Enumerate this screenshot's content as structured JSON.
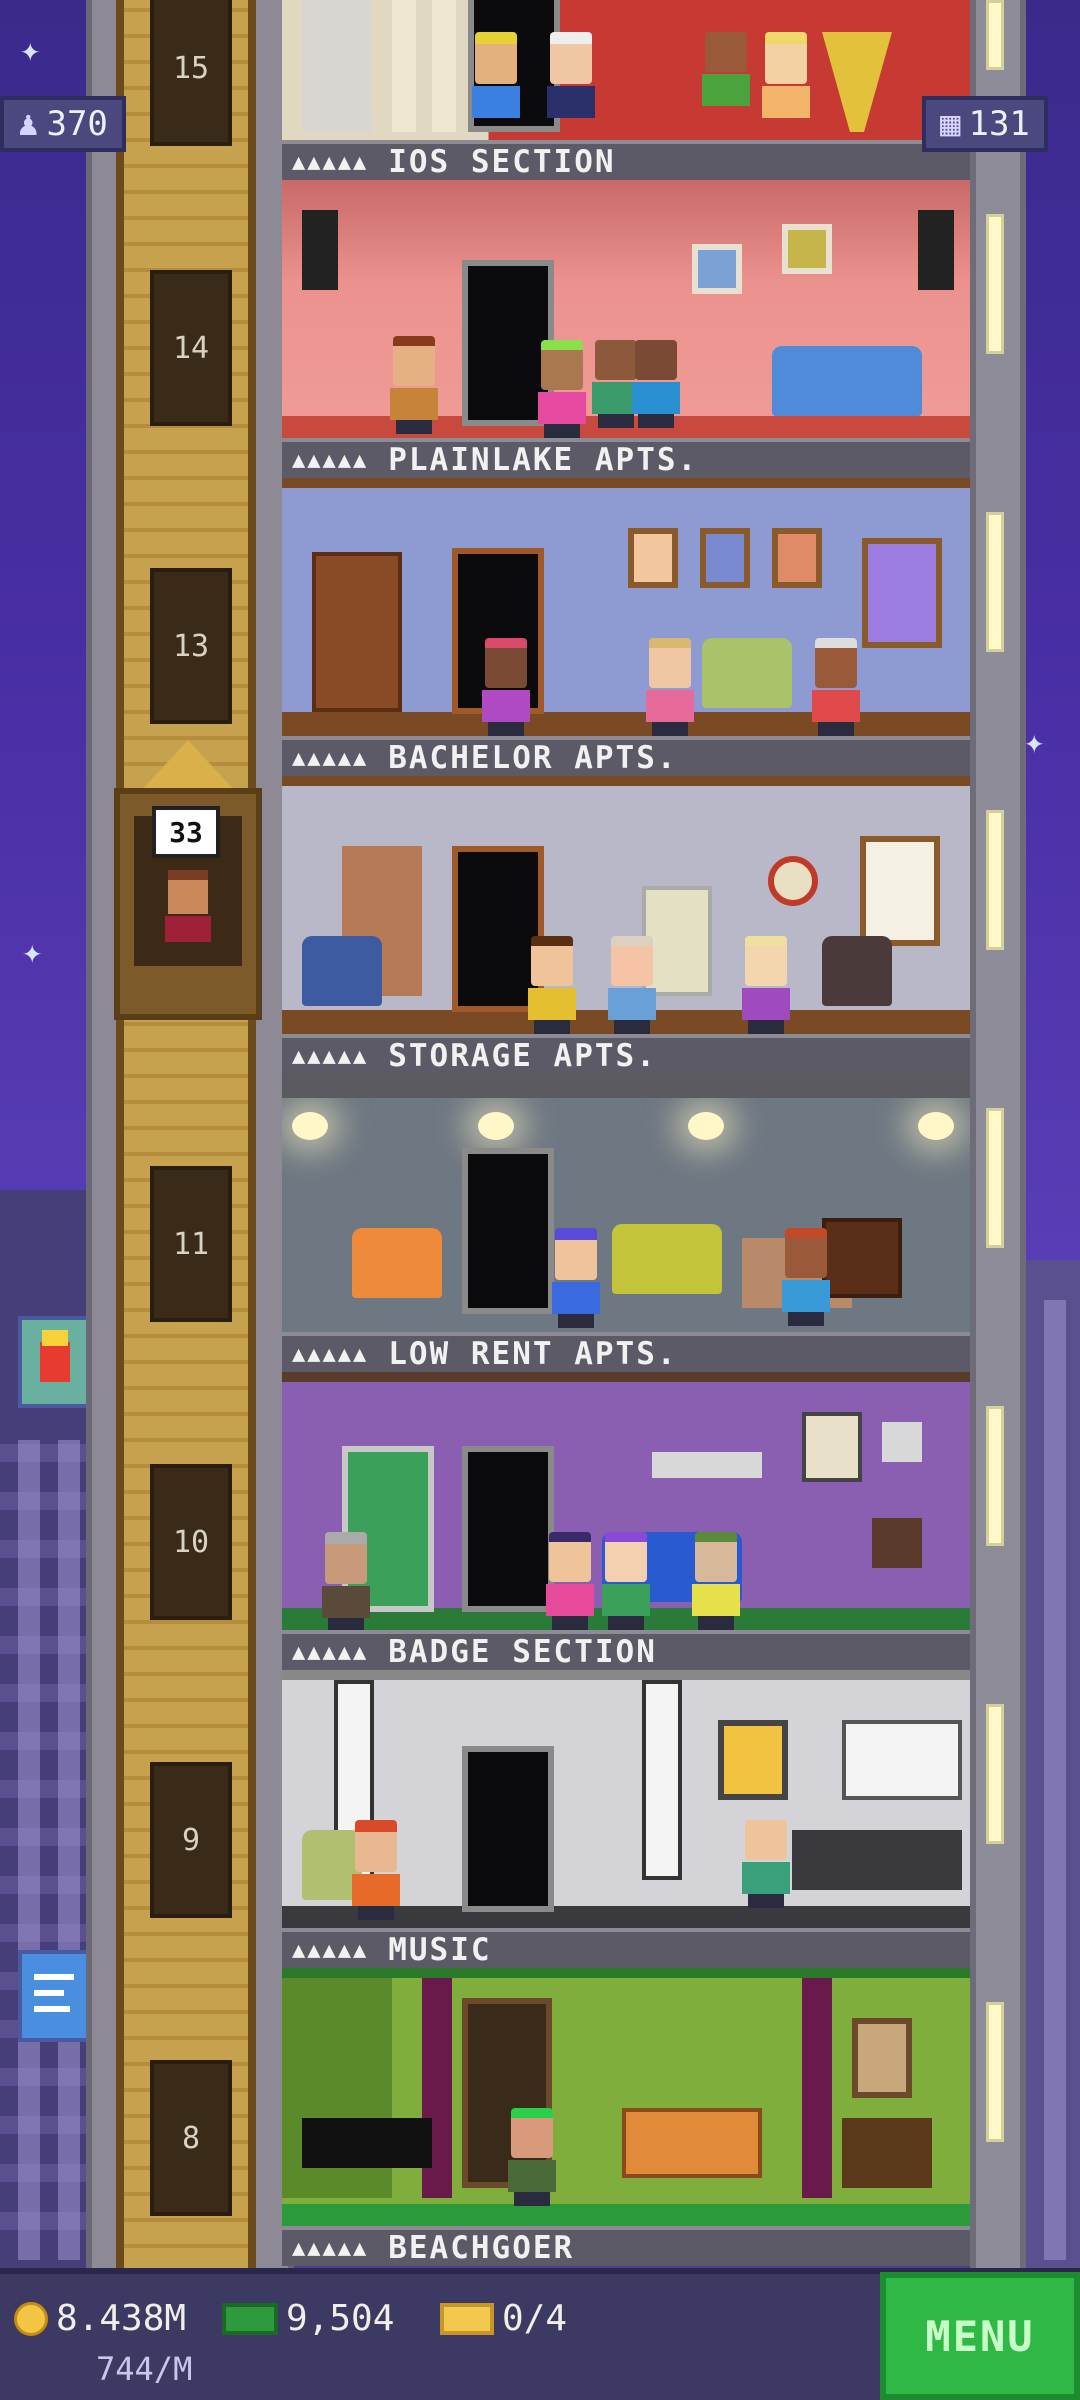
{
  "stats": {
    "population": "370",
    "floors_count": "131"
  },
  "elevator": {
    "speech_value": "33"
  },
  "floor_numbers": [
    "15",
    "14",
    "13",
    "11",
    "10",
    "9",
    "8"
  ],
  "floors": [
    {
      "name": "IOS SECTION",
      "stars": "▲▲▲▲▲",
      "wall": "#d9443c"
    },
    {
      "name": "PLAINLAKE APTS.",
      "stars": "▲▲▲▲▲",
      "wall": "#e98a86"
    },
    {
      "name": "BACHELOR APTS.",
      "stars": "▲▲▲▲▲",
      "wall": "#8e9dd4"
    },
    {
      "name": "STORAGE APTS.",
      "stars": "▲▲▲▲▲",
      "wall": "#b8b7c7"
    },
    {
      "name": "LOW RENT APTS.",
      "stars": "▲▲▲▲▲",
      "wall": "#707b85"
    },
    {
      "name": "BADGE SECTION",
      "stars": "▲▲▲▲▲",
      "wall": "#8b5fb0"
    },
    {
      "name": "MUSIC",
      "stars": "▲▲▲▲▲",
      "wall": "#d6d6d6"
    },
    {
      "name": "BEACHGOER",
      "stars": "▲▲▲▲▲",
      "wall": "#7bab3a"
    }
  ],
  "bottom_bar": {
    "coins": "8.438M",
    "bux": "9,504",
    "tickets": "0/4",
    "rate": "744/M",
    "menu_label": "MENU"
  },
  "icons": {
    "population": "person-icon",
    "floors": "building-icon",
    "coins": "coin-icon",
    "bux": "tower-bux-icon",
    "tickets": "golden-ticket-icon"
  },
  "colors": {
    "menu_green": "#2fb845",
    "sky": "#4a2fa6",
    "label_bar": "#5c5a66"
  }
}
